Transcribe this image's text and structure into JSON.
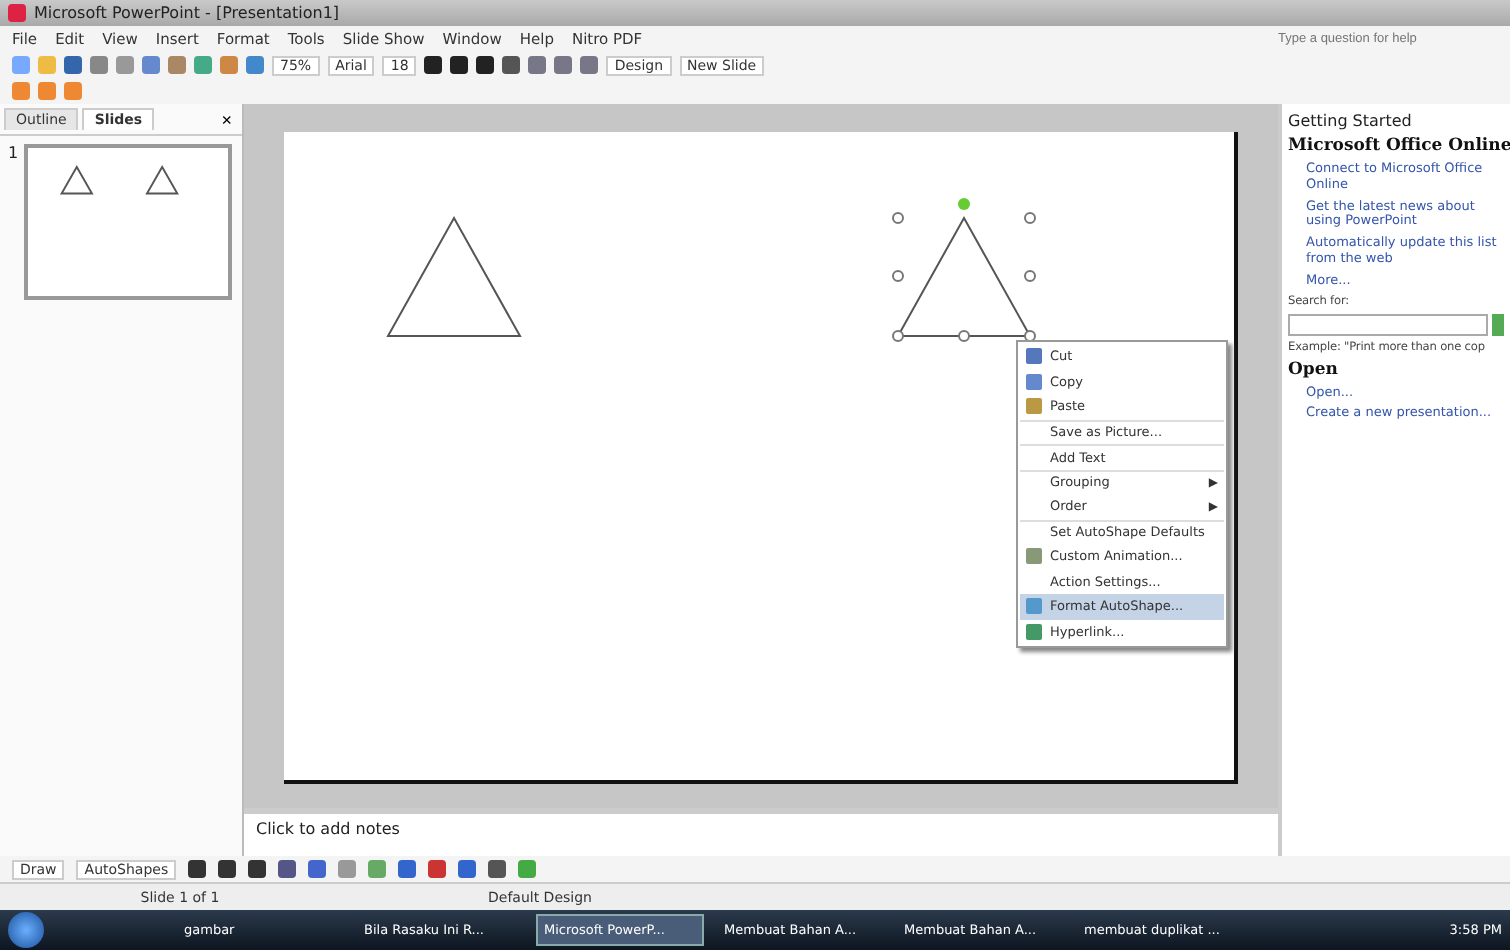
{
  "window": {
    "title": "Microsoft PowerPoint - [Presentation1]"
  },
  "menu": [
    "File",
    "Edit",
    "View",
    "Insert",
    "Format",
    "Tools",
    "Slide Show",
    "Window",
    "Help",
    "Nitro PDF"
  ],
  "help_box": {
    "placeholder": "Type a question for help"
  },
  "toolbar": {
    "zoom": "75%",
    "font": "Arial",
    "size": "18",
    "design": "Design",
    "new_slide": "New Slide"
  },
  "left_pane": {
    "tabs": [
      {
        "label": "Outline",
        "selected": false
      },
      {
        "label": "Slides",
        "selected": true
      }
    ],
    "close": "×",
    "slide_number": "1"
  },
  "slide": {
    "shapes": [
      {
        "kind": "triangle",
        "selected": false
      },
      {
        "kind": "triangle",
        "selected": true
      }
    ]
  },
  "context_menu": [
    {
      "label": "Cut",
      "separator_before": false,
      "selected": false
    },
    {
      "label": "Copy",
      "separator_before": false,
      "selected": false
    },
    {
      "label": "Paste",
      "separator_before": false,
      "selected": false
    },
    {
      "label": "Save as Picture...",
      "separator_before": true,
      "selected": false
    },
    {
      "label": "Add Text",
      "separator_before": true,
      "selected": false
    },
    {
      "label": "Grouping",
      "arrow": "▶",
      "separator_before": true,
      "selected": false
    },
    {
      "label": "Order",
      "arrow": "▶",
      "separator_before": false,
      "selected": false
    },
    {
      "label": "Set AutoShape Defaults",
      "separator_before": true,
      "selected": false
    },
    {
      "label": "Custom Animation...",
      "separator_before": false,
      "selected": false
    },
    {
      "label": "Action Settings...",
      "separator_before": false,
      "selected": false
    },
    {
      "label": "Format AutoShape...",
      "separator_before": false,
      "selected": true
    },
    {
      "label": "Hyperlink...",
      "separator_before": false,
      "selected": false
    }
  ],
  "task_pane": {
    "title": "Getting Started",
    "section": "Microsoft Office Online",
    "links": [
      "Connect to Microsoft Office Online",
      "Get the latest news about using PowerPoint",
      "Automatically update this list from the web"
    ],
    "more": "More...",
    "search_label": "Search for:",
    "example": "Example:  \"Print more than one cop",
    "open_heading": "Open",
    "open_link": "Open...",
    "create_link": "Create a new presentation..."
  },
  "notes": {
    "placeholder": "Click to add notes"
  },
  "drawing_toolbar": {
    "draw": "Draw",
    "autoshapes": "AutoShapes"
  },
  "status_bar": [
    "Slide 1 of 1",
    "Default Design"
  ],
  "taskbar": [
    {
      "label": "gambar",
      "selected": false
    },
    {
      "label": "Bila Rasaku Ini R...",
      "selected": false
    },
    {
      "label": "Microsoft PowerP...",
      "selected": true
    },
    {
      "label": "Membuat Bahan A...",
      "selected": false
    },
    {
      "label": "Membuat Bahan A...",
      "selected": false
    },
    {
      "label": "membuat duplikat ...",
      "selected": false
    }
  ],
  "clock": "3:58 PM"
}
